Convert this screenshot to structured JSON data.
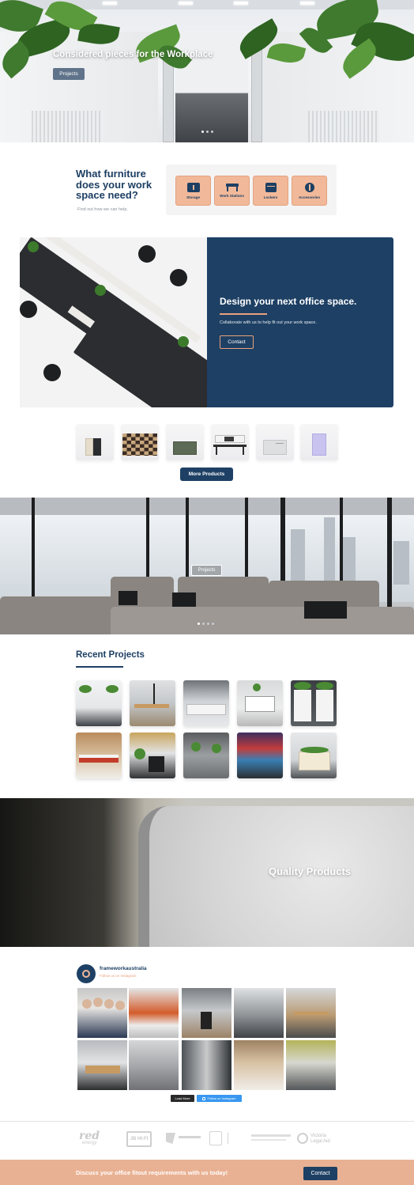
{
  "hero": {
    "title": "Considered pieces for the Workplace",
    "button_label": "Projects",
    "slide_count": 3,
    "active_slide": 1
  },
  "needs": {
    "title": "What furniture does your work space need?",
    "subtitle": "Find out how we can help.",
    "categories": [
      {
        "label": "Storage",
        "icon": "storage-icon"
      },
      {
        "label": "Work Stations",
        "icon": "workstation-icon"
      },
      {
        "label": "Lockers",
        "icon": "locker-icon"
      },
      {
        "label": "Accessories",
        "icon": "accessories-icon"
      }
    ],
    "accent_color": "#f1b99a"
  },
  "design": {
    "title": "Design your next office space.",
    "subtitle": "Collaborate with us to help fit out your work space.",
    "button_label": "Contact",
    "panel_color": "#1e4064"
  },
  "products": {
    "items": [
      "storage-cabinet",
      "acoustic-panel",
      "green-cabinet",
      "workstation-desk",
      "white-drawer-unit",
      "lilac-locker"
    ],
    "button_label": "More Products"
  },
  "office_banner": {
    "button_label": "Projects",
    "slide_count": 4,
    "active_slide": 0
  },
  "recent": {
    "title": "Recent Projects",
    "projects": [
      "project-1",
      "project-2",
      "project-3",
      "project-4",
      "project-5",
      "project-6",
      "project-7",
      "project-8",
      "project-9",
      "project-10"
    ]
  },
  "quality": {
    "title": "Quality Products"
  },
  "instagram": {
    "username": "frameworkaustralia",
    "follow_text": "Follow us on Instagram",
    "load_more_label": "Load More",
    "follow_button_label": "Follow on Instagram",
    "post_count": 10
  },
  "clients": {
    "logos": [
      "red energy",
      "JB HI-FI",
      "GRA",
      "VCA",
      "Victoria Legal Aid"
    ],
    "red": "red",
    "energy": "energy",
    "jb": "JB HI-FI",
    "vla_line1": "Victoria",
    "vla_line2": "Legal Aid"
  },
  "cta": {
    "text": "Discuss your office fitout requirements with us today!",
    "button_label": "Contact",
    "background": "#e9b193"
  }
}
